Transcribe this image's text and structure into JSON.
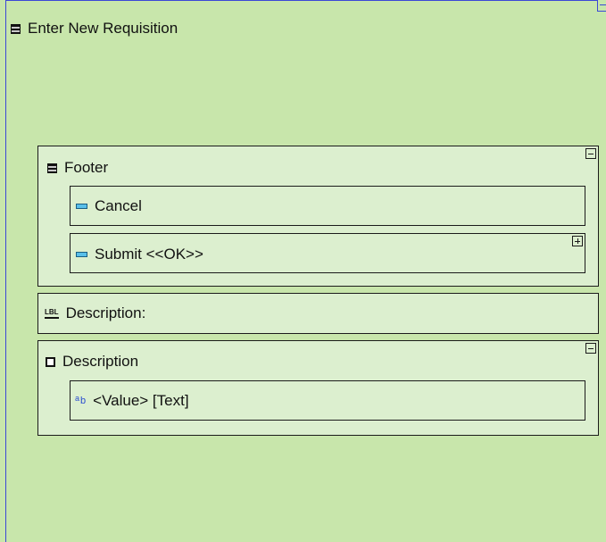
{
  "window": {
    "title": "Enter New Requisition"
  },
  "footer": {
    "title": "Footer",
    "items": [
      {
        "label": "Cancel"
      },
      {
        "label": "Submit <<OK>>"
      }
    ]
  },
  "description_label": {
    "label": "Description:"
  },
  "description_group": {
    "title": "Description",
    "field": {
      "label": "<Value> [Text]"
    }
  },
  "icons": {
    "window": "form-icon",
    "footer": "form-icon",
    "cancel": "button-icon",
    "submit": "button-icon",
    "description_label": "label-icon",
    "description_group": "frame-icon",
    "text_field": "text-field-icon"
  },
  "colors": {
    "background": "#c8e6ab",
    "panel": "#dcefcf",
    "border": "#1b1b1b",
    "selection_border": "#3b48d6"
  }
}
